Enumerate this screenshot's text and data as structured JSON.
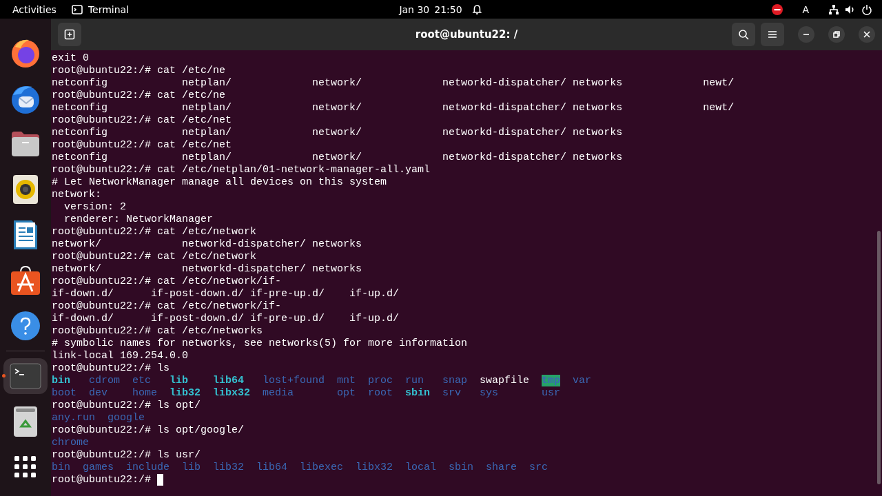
{
  "top_bar": {
    "activities": "Activities",
    "app_name": "Terminal",
    "date": "Jan 30",
    "time": "21:50",
    "keyboard": "A"
  },
  "dock": {
    "items": [
      {
        "kind": "firefox",
        "running": false
      },
      {
        "kind": "thunderbird",
        "running": false
      },
      {
        "kind": "files",
        "running": false
      },
      {
        "kind": "rhythmbox",
        "running": false
      },
      {
        "kind": "writer",
        "running": false
      },
      {
        "kind": "appcenter",
        "running": false
      },
      {
        "kind": "help",
        "running": false
      },
      {
        "kind": "separator"
      },
      {
        "kind": "terminal",
        "running": true
      },
      {
        "kind": "trash",
        "running": false
      },
      {
        "kind": "apps",
        "running": false
      }
    ]
  },
  "window": {
    "title": "root@ubuntu22: /"
  },
  "terminal": {
    "lines": [
      {
        "kind": "text",
        "text": "exit 0"
      },
      {
        "kind": "text",
        "text": "root@ubuntu22:/# cat /etc/ne"
      },
      {
        "kind": "text",
        "text": "netconfig            netplan/             network/             networkd-dispatcher/ networks             newt/"
      },
      {
        "kind": "text",
        "text": "root@ubuntu22:/# cat /etc/ne"
      },
      {
        "kind": "text",
        "text": "netconfig            netplan/             network/             networkd-dispatcher/ networks             newt/"
      },
      {
        "kind": "text",
        "text": "root@ubuntu22:/# cat /etc/net"
      },
      {
        "kind": "text",
        "text": "netconfig            netplan/             network/             networkd-dispatcher/ networks"
      },
      {
        "kind": "text",
        "text": "root@ubuntu22:/# cat /etc/net"
      },
      {
        "kind": "text",
        "text": "netconfig            netplan/             network/             networkd-dispatcher/ networks"
      },
      {
        "kind": "text",
        "text": "root@ubuntu22:/# cat /etc/netplan/01-network-manager-all.yaml"
      },
      {
        "kind": "text",
        "text": "# Let NetworkManager manage all devices on this system"
      },
      {
        "kind": "text",
        "text": "network:"
      },
      {
        "kind": "text",
        "text": "  version: 2"
      },
      {
        "kind": "text",
        "text": "  renderer: NetworkManager"
      },
      {
        "kind": "text",
        "text": "root@ubuntu22:/# cat /etc/network"
      },
      {
        "kind": "text",
        "text": "network/             networkd-dispatcher/ networks"
      },
      {
        "kind": "text",
        "text": "root@ubuntu22:/# cat /etc/network"
      },
      {
        "kind": "text",
        "text": "network/             networkd-dispatcher/ networks"
      },
      {
        "kind": "text",
        "text": "root@ubuntu22:/# cat /etc/network/if-"
      },
      {
        "kind": "text",
        "text": "if-down.d/      if-post-down.d/ if-pre-up.d/    if-up.d/"
      },
      {
        "kind": "text",
        "text": "root@ubuntu22:/# cat /etc/network/if-"
      },
      {
        "kind": "text",
        "text": "if-down.d/      if-post-down.d/ if-pre-up.d/    if-up.d/"
      },
      {
        "kind": "text",
        "text": "root@ubuntu22:/# cat /etc/networks"
      },
      {
        "kind": "text",
        "text": "# symbolic names for networks, see networks(5) for more information"
      },
      {
        "kind": "text",
        "text": "link-local 169.254.0.0"
      },
      {
        "kind": "text",
        "text": "root@ubuntu22:/# ls"
      },
      {
        "kind": "listing",
        "rows": [
          [
            {
              "name": "bin",
              "kind": "link"
            },
            {
              "name": "cdrom",
              "kind": "dir"
            },
            {
              "name": "etc",
              "kind": "dir"
            },
            {
              "name": "lib",
              "kind": "link"
            },
            {
              "name": "lib64",
              "kind": "link"
            },
            {
              "name": "lost+found",
              "kind": "dir"
            },
            {
              "name": "mnt",
              "kind": "dir"
            },
            {
              "name": "proc",
              "kind": "dir"
            },
            {
              "name": "run",
              "kind": "dir"
            },
            {
              "name": "snap",
              "kind": "dir"
            },
            {
              "name": "swapfile",
              "kind": "file"
            },
            {
              "name": "tmp",
              "kind": "sticky"
            },
            {
              "name": "var",
              "kind": "dir"
            }
          ],
          [
            {
              "name": "boot",
              "kind": "dir"
            },
            {
              "name": "dev",
              "kind": "dir"
            },
            {
              "name": "home",
              "kind": "dir"
            },
            {
              "name": "lib32",
              "kind": "link"
            },
            {
              "name": "libx32",
              "kind": "link"
            },
            {
              "name": "media",
              "kind": "dir"
            },
            {
              "name": "opt",
              "kind": "dir"
            },
            {
              "name": "root",
              "kind": "dir"
            },
            {
              "name": "sbin",
              "kind": "link"
            },
            {
              "name": "srv",
              "kind": "dir"
            },
            {
              "name": "sys",
              "kind": "dir"
            },
            {
              "name": "usr",
              "kind": "dir"
            }
          ]
        ]
      },
      {
        "kind": "text",
        "text": "root@ubuntu22:/# ls opt/"
      },
      {
        "kind": "listing",
        "rows": [
          [
            {
              "name": "any.run",
              "kind": "dir"
            },
            {
              "name": "google",
              "kind": "dir"
            }
          ]
        ]
      },
      {
        "kind": "text",
        "text": "root@ubuntu22:/# ls opt/google/"
      },
      {
        "kind": "listing",
        "rows": [
          [
            {
              "name": "chrome",
              "kind": "dir"
            }
          ]
        ]
      },
      {
        "kind": "text",
        "text": "root@ubuntu22:/# ls usr/"
      },
      {
        "kind": "listing",
        "rows": [
          [
            {
              "name": "bin",
              "kind": "dir"
            },
            {
              "name": "games",
              "kind": "dir"
            },
            {
              "name": "include",
              "kind": "dir"
            },
            {
              "name": "lib",
              "kind": "dir"
            },
            {
              "name": "lib32",
              "kind": "dir"
            },
            {
              "name": "lib64",
              "kind": "dir"
            },
            {
              "name": "libexec",
              "kind": "dir"
            },
            {
              "name": "libx32",
              "kind": "dir"
            },
            {
              "name": "local",
              "kind": "dir"
            },
            {
              "name": "sbin",
              "kind": "dir"
            },
            {
              "name": "share",
              "kind": "dir"
            },
            {
              "name": "src",
              "kind": "dir"
            }
          ]
        ]
      },
      {
        "kind": "prompt",
        "text": "root@ubuntu22:/# "
      }
    ]
  }
}
